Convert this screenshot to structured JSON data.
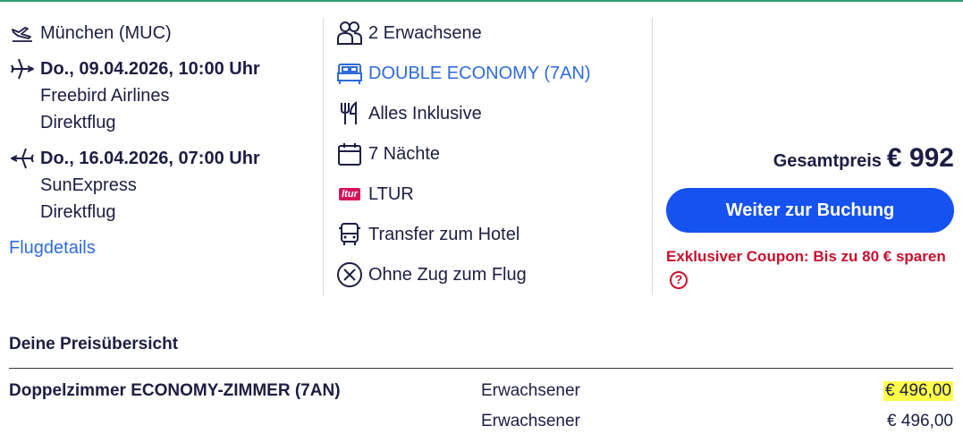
{
  "flight": {
    "departure_airport": "München (MUC)",
    "outbound": {
      "datetime": "Do., 09.04.2026, 10:00 Uhr",
      "airline": "Freebird Airlines",
      "type": "Direktflug"
    },
    "return": {
      "datetime": "Do., 16.04.2026, 07:00 Uhr",
      "airline": "SunExpress",
      "type": "Direktflug"
    },
    "details_link": "Flugdetails"
  },
  "trip": {
    "travelers": "2 Erwachsene",
    "room": "DOUBLE ECONOMY (7AN)",
    "board": "Alles Inklusive",
    "nights": "7 Nächte",
    "operator_badge": "ltur",
    "operator": "LTUR",
    "transfer": "Transfer zum Hotel",
    "train": "Ohne Zug zum Flug"
  },
  "booking": {
    "total_label": "Gesamtpreis",
    "total_value": "€ 992",
    "button_label": "Weiter zur Buchung",
    "coupon_text": "Exklusiver Coupon: Bis zu 80 € sparen",
    "coupon_help": "?"
  },
  "price_overview": {
    "title": "Deine Preisübersicht",
    "rows": [
      {
        "room": "Doppelzimmer ECONOMY-ZIMMER (7AN)",
        "type": "Erwachsener",
        "price": "€ 496,00"
      },
      {
        "room": "",
        "type": "Erwachsener",
        "price": "€ 496,00"
      }
    ]
  },
  "colors": {
    "accent": "#1652f0",
    "link": "#2e6bd8",
    "coupon": "#c8102e",
    "highlight": "#ffff4a",
    "top_line": "#2f9e6e"
  }
}
